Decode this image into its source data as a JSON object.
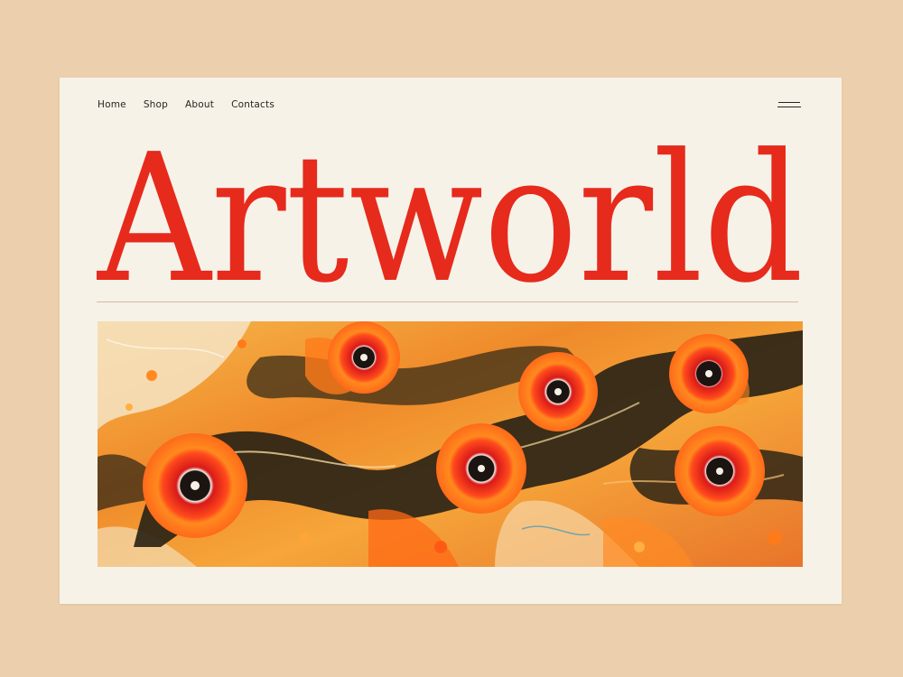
{
  "nav": {
    "items": [
      {
        "label": "Home"
      },
      {
        "label": "Shop"
      },
      {
        "label": "About"
      },
      {
        "label": "Contacts"
      }
    ]
  },
  "menu_icon": "hamburger-menu-icon",
  "hero": {
    "title": "Artworld",
    "image": "marbled-flower-artwork"
  },
  "colors": {
    "page_background": "#eccfad",
    "card_background": "#f6f2e8",
    "title_red": "#e62a1c",
    "nav_text": "#2a2420",
    "divider": "#d9b9a6"
  }
}
